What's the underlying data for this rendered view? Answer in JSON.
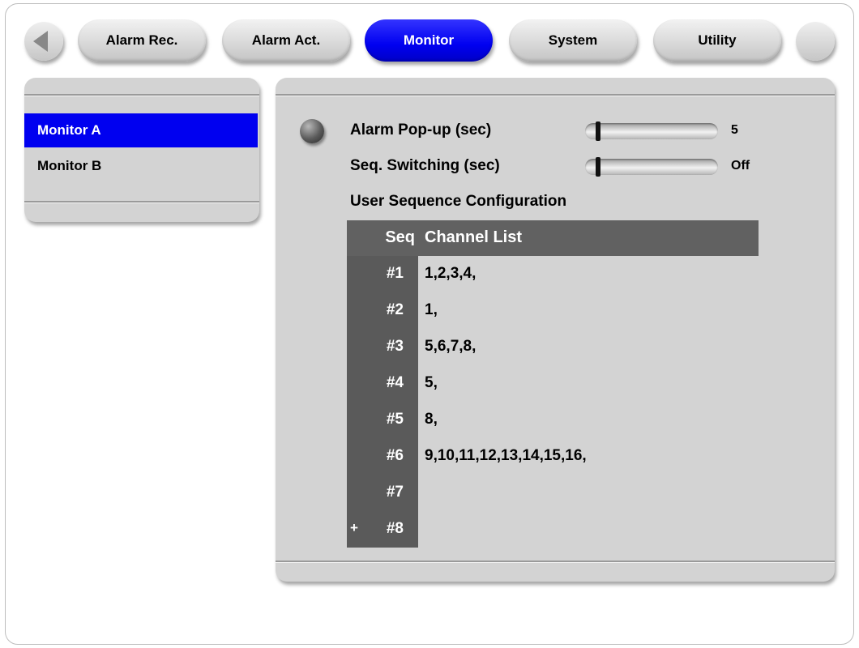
{
  "tabs": [
    {
      "label": "Alarm Rec.",
      "active": false
    },
    {
      "label": "Alarm Act.",
      "active": false
    },
    {
      "label": "Monitor",
      "active": true
    },
    {
      "label": "System",
      "active": false
    },
    {
      "label": "Utility",
      "active": false
    }
  ],
  "sidebar": {
    "items": [
      {
        "label": "Monitor A",
        "selected": true
      },
      {
        "label": "Monitor B",
        "selected": false
      }
    ]
  },
  "settings": {
    "alarm_popup": {
      "label": "Alarm Pop-up (sec)",
      "value": "5"
    },
    "seq_switching": {
      "label": "Seq. Switching (sec)",
      "value": "Off"
    },
    "user_sequence_title": "User Sequence Configuration"
  },
  "sequence_table": {
    "headers": [
      "Seq",
      "Channel List"
    ],
    "rows": [
      {
        "seq": "#1",
        "channels": "1,2,3,4,"
      },
      {
        "seq": "#2",
        "channels": "1,"
      },
      {
        "seq": "#3",
        "channels": "5,6,7,8,"
      },
      {
        "seq": "#4",
        "channels": "5,"
      },
      {
        "seq": "#5",
        "channels": "8,"
      },
      {
        "seq": "#6",
        "channels": "9,10,11,12,13,14,15,16,"
      },
      {
        "seq": "#7",
        "channels": ""
      },
      {
        "seq": "#8",
        "channels": "",
        "marker": "+"
      }
    ]
  },
  "icons": [
    "back-arrow-icon",
    "next-round-icon",
    "settings-bullet-icon",
    "slider-knob-icon"
  ],
  "colors": {
    "accent": "#0000f0",
    "panel": "#d3d3d3",
    "table_header": "#616161"
  }
}
